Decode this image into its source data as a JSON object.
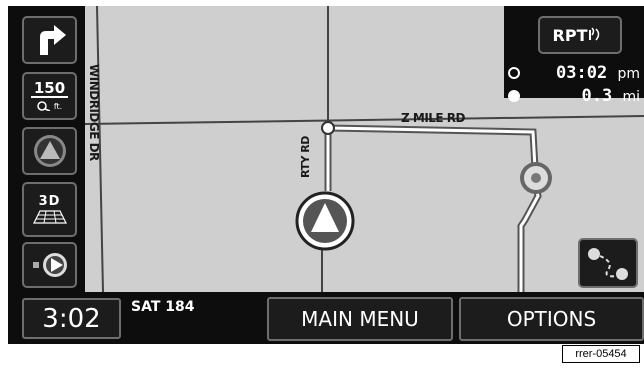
{
  "map": {
    "streets": [
      "WINDRIDGE DR",
      "Z MILE RD",
      "RTY RD"
    ]
  },
  "left_controls": {
    "scale_value": "150",
    "scale_unit": "ft.",
    "view_mode_label": "3D"
  },
  "top_right": {
    "repeat_label": "RPT",
    "eta_time": "03:02",
    "eta_unit": "pm",
    "distance_value": "0.3",
    "distance_unit": "mi"
  },
  "bottom_bar": {
    "clock": "3:02",
    "satellite_status": "SAT 184",
    "main_menu_label": "MAIN MENU",
    "options_label": "OPTIONS"
  },
  "reference_code": "rrer-05454",
  "icons": [
    "turn-right-arrow-icon",
    "zoom-scale-icon",
    "north-up-compass-icon",
    "3d-view-icon",
    "route-guidance-icon",
    "speaker-icon",
    "clock-icon",
    "destination-pin-icon",
    "vehicle-position-icon",
    "reroute-icon"
  ]
}
